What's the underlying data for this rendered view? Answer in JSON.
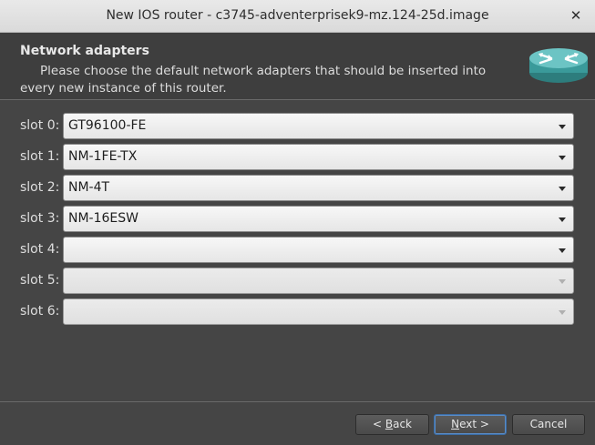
{
  "window": {
    "title": "New IOS router - c3745-adventerprisek9-mz.124-25d.image",
    "close_icon": "close-icon"
  },
  "header": {
    "title": "Network adapters",
    "subtitle": "Please choose the default network adapters that should be inserted into every new instance of this router.",
    "icon": "router-icon"
  },
  "slots": [
    {
      "label": "slot 0:",
      "value": "GT96100-FE",
      "enabled": true
    },
    {
      "label": "slot 1:",
      "value": "NM-1FE-TX",
      "enabled": true
    },
    {
      "label": "slot 2:",
      "value": "NM-4T",
      "enabled": true
    },
    {
      "label": "slot 3:",
      "value": "NM-16ESW",
      "enabled": true
    },
    {
      "label": "slot 4:",
      "value": "",
      "enabled": true
    },
    {
      "label": "slot 5:",
      "value": "",
      "enabled": false
    },
    {
      "label": "slot 6:",
      "value": "",
      "enabled": false
    }
  ],
  "buttons": {
    "back_prefix": "< ",
    "back_mnemonic": "B",
    "back_rest": "ack",
    "next_mnemonic": "N",
    "next_rest": "ext >",
    "cancel": "Cancel"
  },
  "colors": {
    "background": "#454545",
    "header_bg": "#3e3e3e",
    "titlebar": "#e2e2e2",
    "primary_button_border": "#3b6ea8"
  }
}
